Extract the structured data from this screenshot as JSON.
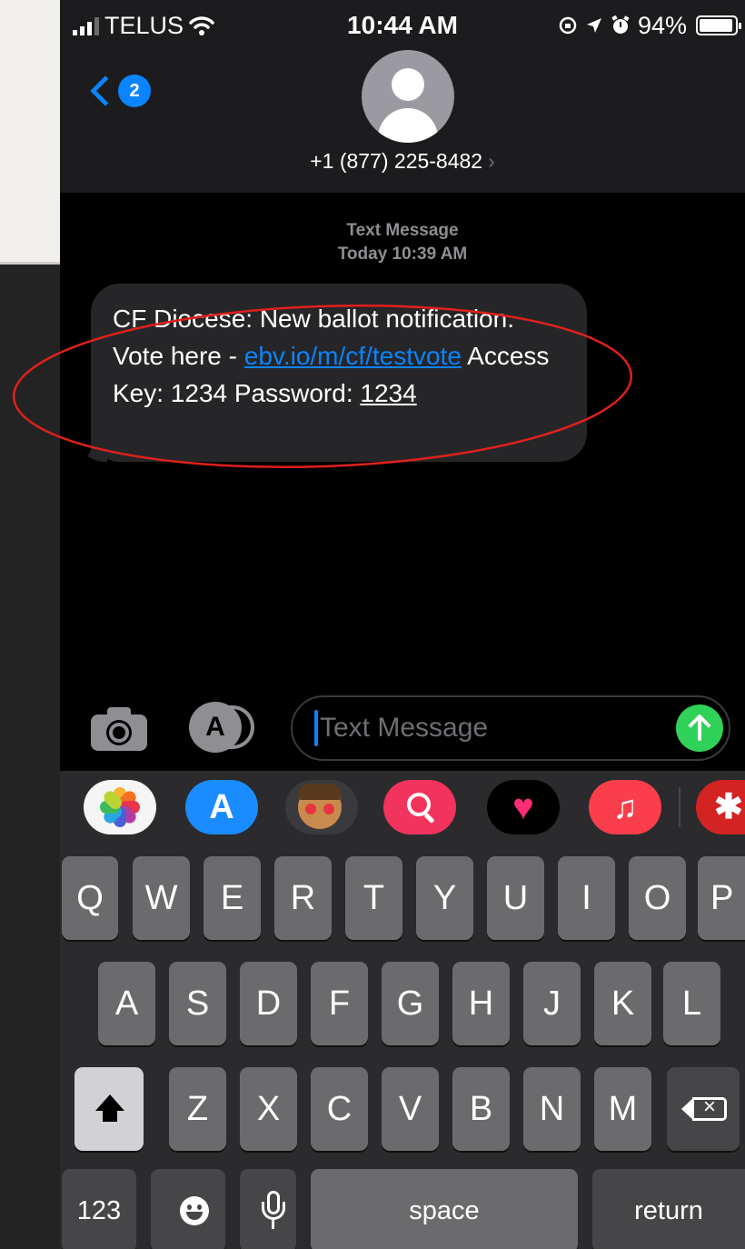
{
  "status_bar": {
    "carrier": "TELUS",
    "time": "10:44 AM",
    "battery_percent": "94%",
    "battery_level": 0.94
  },
  "header": {
    "back_badge_count": "2",
    "contact_number": "+1 (877) 225-8482",
    "contact_chevron": "›"
  },
  "conversation": {
    "service_label": "Text Message",
    "timestamp": "Today 10:39 AM",
    "message": {
      "part1": "CF Diocese: New ballot notification. Vote here - ",
      "link": "ebv.io/m/cf/testvote",
      "part2": " Access Key: 1234 Password: ",
      "password": "1234"
    }
  },
  "input_bar": {
    "placeholder": "Text Message"
  },
  "app_strip": {
    "apps": [
      "photos-app",
      "app-store-app",
      "memoji-app",
      "search-app",
      "digital-touch-app",
      "music-app",
      "yelp-app"
    ]
  },
  "keyboard": {
    "row1": [
      "Q",
      "W",
      "E",
      "R",
      "T",
      "Y",
      "U",
      "I",
      "O",
      "P"
    ],
    "row2": [
      "A",
      "S",
      "D",
      "F",
      "G",
      "H",
      "J",
      "K",
      "L"
    ],
    "row3": [
      "Z",
      "X",
      "C",
      "V",
      "B",
      "N",
      "M"
    ],
    "numbers_label": "123",
    "space_label": "space",
    "return_label": "return"
  },
  "colors": {
    "accent_blue": "#0a84ff",
    "send_green": "#30d158",
    "annotation_red": "#e0201c",
    "bubble_gray": "#262628"
  }
}
